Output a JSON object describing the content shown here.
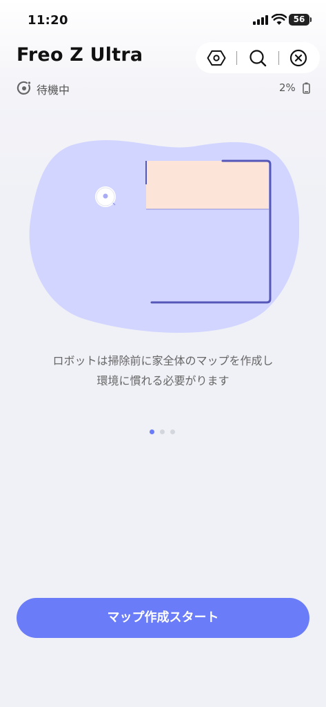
{
  "status_bar": {
    "time": "11:20",
    "battery_level": "56"
  },
  "header": {
    "title": "Freo Z Ultra",
    "toolbar_icons": [
      "settings-icon",
      "search-icon",
      "close-icon"
    ]
  },
  "device_status": {
    "state_text": "待機中",
    "battery_percent": "2%"
  },
  "onboarding": {
    "description_line1": "ロボットは掃除前に家全体のマップを作成し",
    "description_line2": "環境に慣れる必要がります",
    "page_count": 3,
    "active_page": 1
  },
  "action": {
    "start_label": "マップ作成スタート"
  },
  "colors": {
    "accent": "#6a7cf7",
    "blob": "#d2d5ff",
    "wall": "#5557b8",
    "room_highlight": "#fde4d8",
    "page_bg": "#f0f1f6"
  }
}
